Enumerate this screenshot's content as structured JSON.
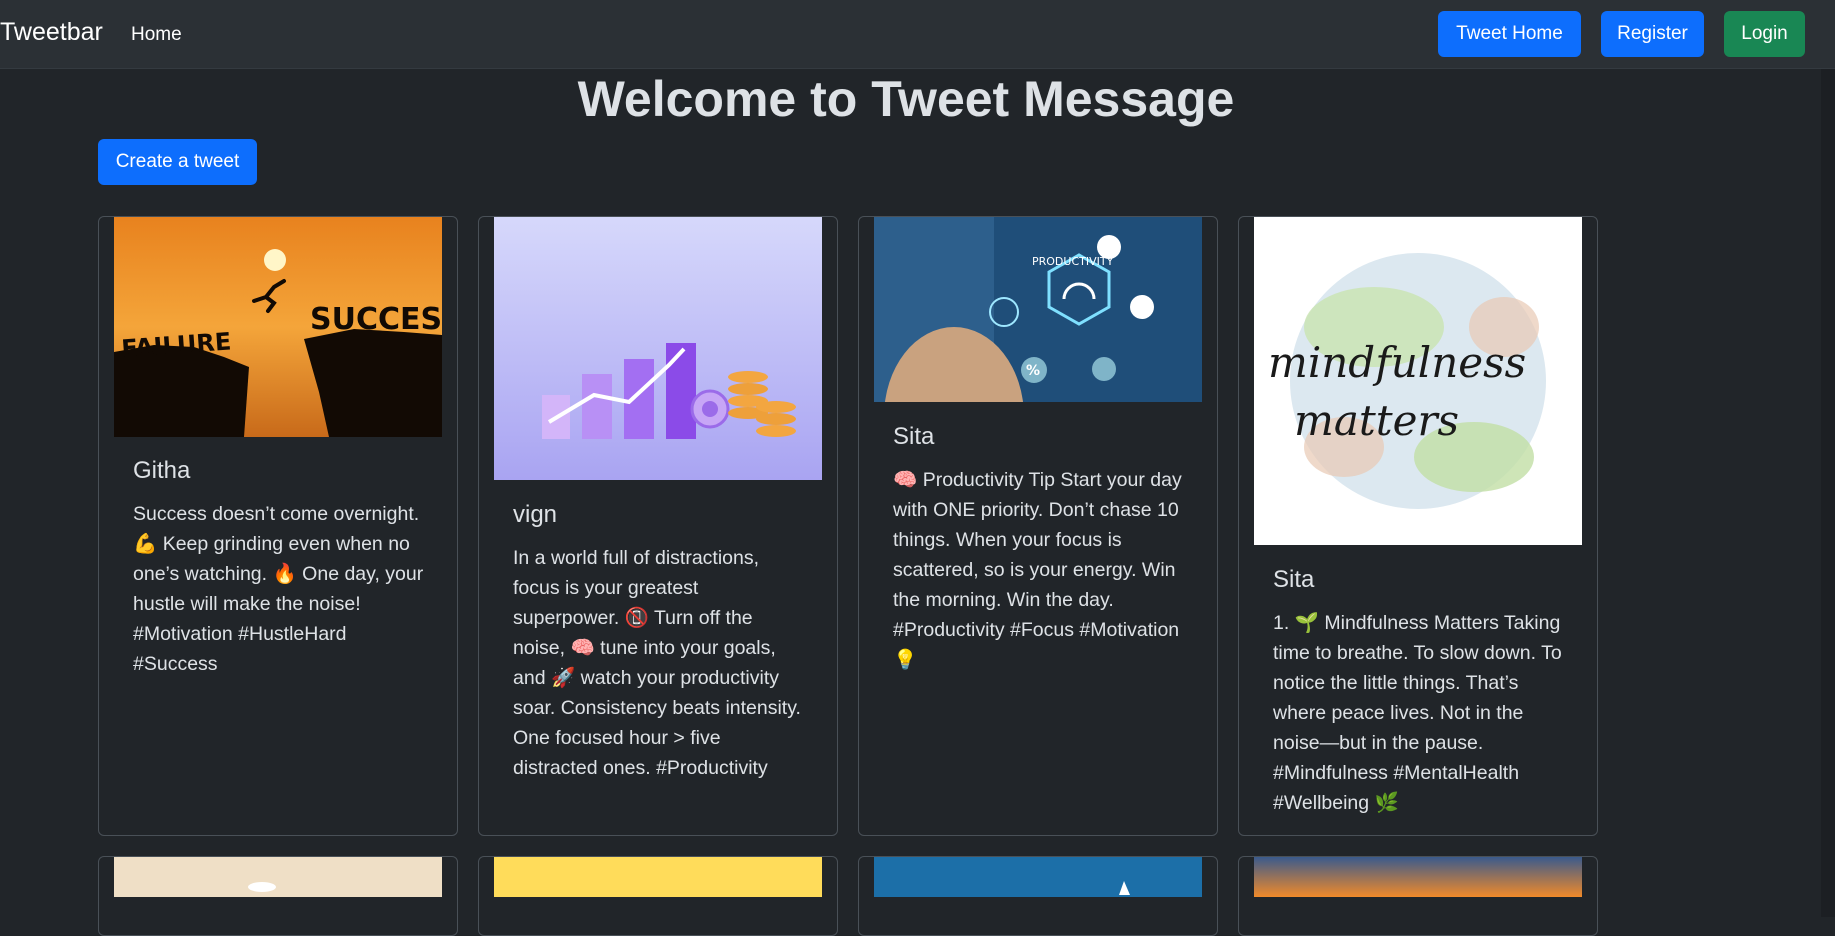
{
  "navbar": {
    "brand": "Tweetbar",
    "home": "Home",
    "tweet_home": "Tweet Home",
    "register": "Register",
    "login": "Login"
  },
  "page": {
    "title": "Welcome to Tweet Message",
    "create_button": "Create a tweet"
  },
  "tweets": [
    {
      "author": "Githa",
      "text": "Success doesn’t come overnight. 💪 Keep grinding even when no one’s watching. 🔥 One day, your hustle will make the noise! #Motivation #HustleHard #Success",
      "image_label": "FAILURE SUCCESS"
    },
    {
      "author": "vign",
      "text": "In a world full of distractions, focus is your greatest superpower. 📵 Turn off the noise, 🧠 tune into your goals, and 🚀 watch your productivity soar. Consistency beats intensity. One focused hour > five distracted ones. #Productivity"
    },
    {
      "author": "Sita",
      "text": "🧠 Productivity Tip Start your day with ONE priority. Don’t chase 10 things. When your focus is scattered, so is your energy. Win the morning. Win the day. #Productivity #Focus #Motivation 💡",
      "image_label": "PRODUCTIVITY"
    },
    {
      "author": "Sita",
      "text": "1. 🌱 Mindfulness Matters Taking time to breathe. To slow down. To notice the little things. That’s where peace lives. Not in the noise—but in the pause. #Mindfulness #MentalHealth #Wellbeing 🌿",
      "image_label": "mindfulness matters"
    }
  ],
  "colors": {
    "background": "#212529",
    "navbar": "#2b3035",
    "primary": "#0d6efd",
    "success": "#198754"
  }
}
